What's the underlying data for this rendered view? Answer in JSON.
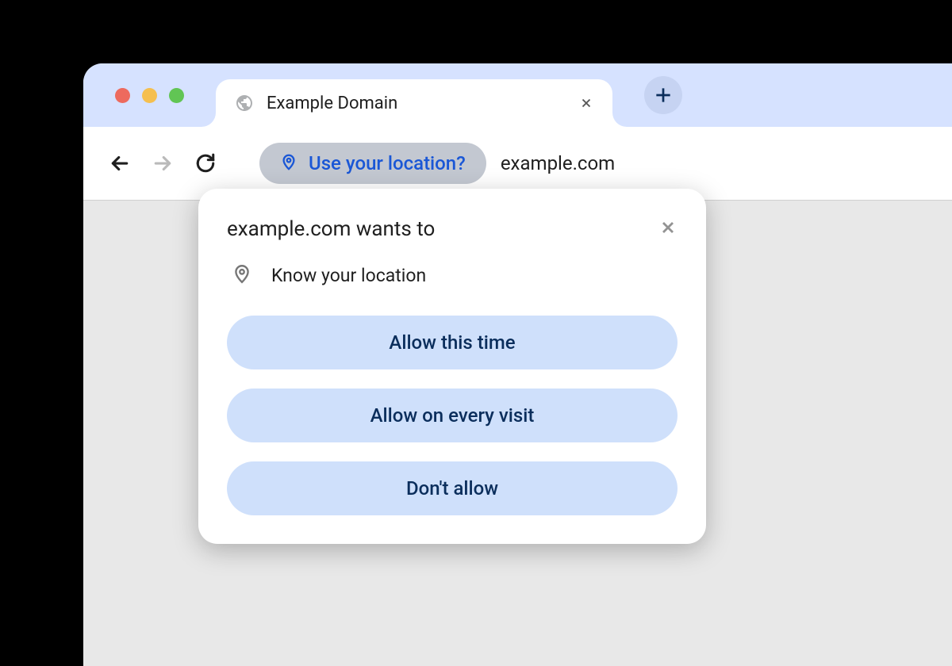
{
  "tab": {
    "title": "Example Domain"
  },
  "omnibox": {
    "chip_label": "Use your location?",
    "url": "example.com"
  },
  "popup": {
    "title": "example.com wants to",
    "permission_label": "Know your location",
    "buttons": {
      "allow_once": "Allow this time",
      "allow_always": "Allow on every visit",
      "deny": "Don't allow"
    }
  }
}
